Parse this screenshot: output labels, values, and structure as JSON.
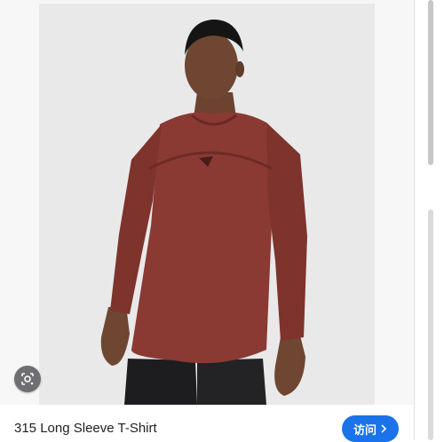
{
  "product": {
    "title": "315 Long Sleeve T-Shirt",
    "visit_label": "访问"
  },
  "icons": {
    "lens": "google-lens-icon",
    "chevron": "chevron-right-icon"
  },
  "colors": {
    "accent": "#1a73e8",
    "shirt": "#8a3a33",
    "panel": "#f7f7f8"
  }
}
